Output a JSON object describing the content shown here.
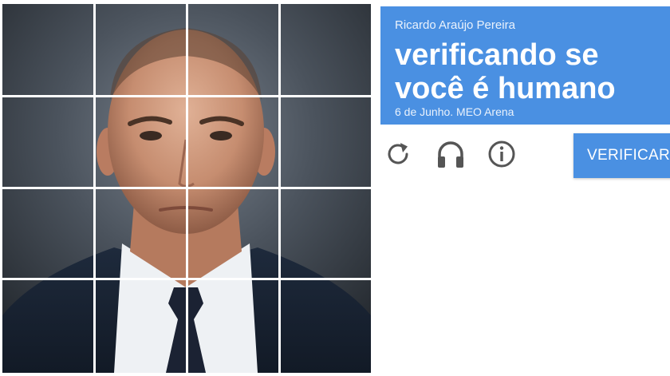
{
  "challenge": {
    "grid_rows": 4,
    "grid_cols": 4
  },
  "header": {
    "subtitle": "Ricardo Araújo Pereira",
    "title": "verificando se você é humano",
    "caption": "6 de Junho. MEO Arena"
  },
  "controls": {
    "reload_icon": "reload-icon",
    "audio_icon": "headphones-icon",
    "info_icon": "info-icon",
    "verify_label": "VERIFICAR"
  },
  "colors": {
    "accent": "#4a90e2",
    "icon": "#555555",
    "background": "#ffffff"
  }
}
